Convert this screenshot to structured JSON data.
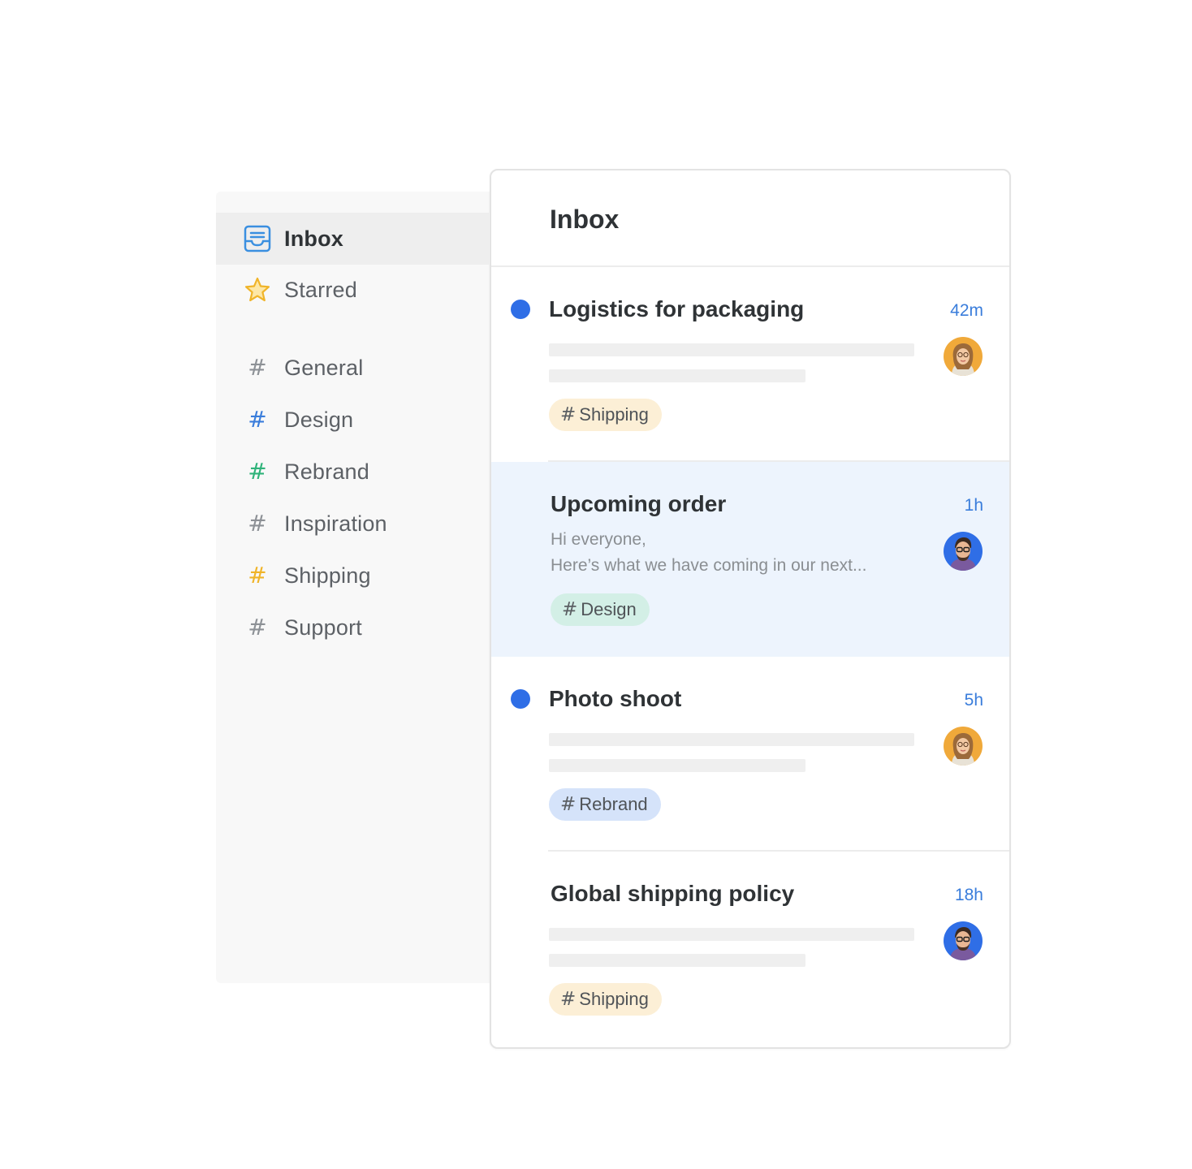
{
  "sidebar": {
    "items": [
      {
        "label": "Inbox",
        "icon": "inbox-tray-icon",
        "color": "#3a8fe0",
        "active": true
      },
      {
        "label": "Starred",
        "icon": "star-icon",
        "color": "#f0b429",
        "active": false
      }
    ],
    "channels": [
      {
        "label": "General",
        "color": "#8d9196"
      },
      {
        "label": "Design",
        "color": "#3a7ddb"
      },
      {
        "label": "Rebrand",
        "color": "#2fb37a"
      },
      {
        "label": "Inspiration",
        "color": "#8d9196"
      },
      {
        "label": "Shipping",
        "color": "#f0b429"
      },
      {
        "label": "Support",
        "color": "#8d9196"
      }
    ]
  },
  "inbox": {
    "title": "Inbox",
    "messages": [
      {
        "title": "Logistics for packaging",
        "time": "42m",
        "unread": true,
        "tag": "Shipping",
        "tag_bg": "#fcefd6",
        "avatar": "woman-avatar"
      },
      {
        "title": "Upcoming order",
        "time": "1h",
        "unread": false,
        "selected": true,
        "preview_line1": "Hi everyone,",
        "preview_line2": "Here’s what we have coming in our next...",
        "tag": "Design",
        "tag_bg": "#d3efe6",
        "avatar": "man-avatar"
      },
      {
        "title": "Photo shoot",
        "time": "5h",
        "unread": true,
        "tag": "Rebrand",
        "tag_bg": "#d5e3fa",
        "avatar": "woman-avatar"
      },
      {
        "title": "Global shipping policy",
        "time": "18h",
        "unread": false,
        "tag": "Shipping",
        "tag_bg": "#fcefd6",
        "avatar": "man-avatar"
      }
    ]
  },
  "colors": {
    "accent": "#2f6ee6",
    "time": "#3a7ddb",
    "selected_bg": "#edf4fd"
  }
}
